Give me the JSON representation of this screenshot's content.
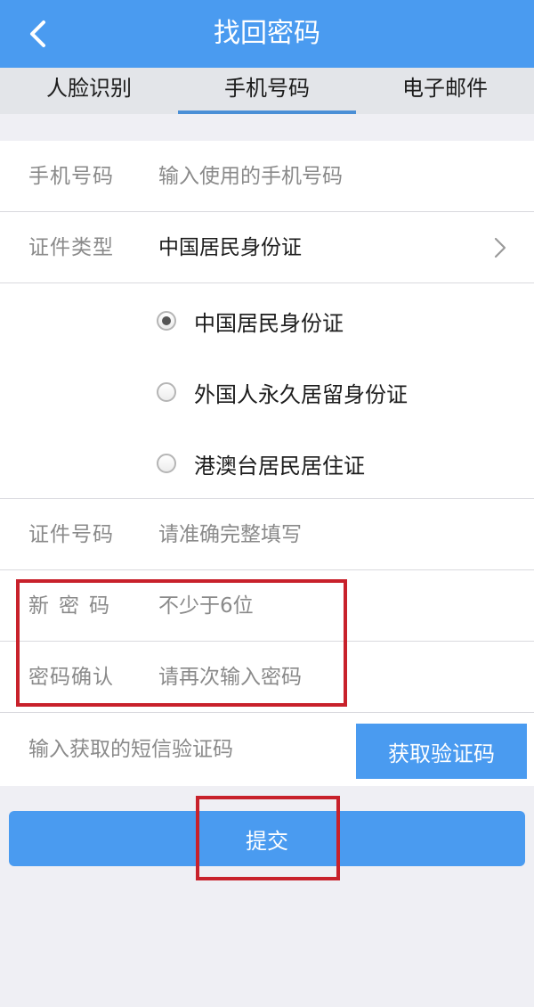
{
  "header": {
    "title": "找回密码",
    "back_icon": "chevron-left-icon"
  },
  "tabs": [
    {
      "label": "人脸识别",
      "active": false
    },
    {
      "label": "手机号码",
      "active": true
    },
    {
      "label": "电子邮件",
      "active": false
    }
  ],
  "form": {
    "phone": {
      "label": "手机号码",
      "placeholder": "输入使用的手机号码"
    },
    "id_type": {
      "label": "证件类型",
      "value": "中国居民身份证",
      "chevron_icon": "chevron-right-icon",
      "options": [
        {
          "label": "中国居民身份证",
          "selected": true
        },
        {
          "label": "外国人永久居留身份证",
          "selected": false
        },
        {
          "label": "港澳台居民居住证",
          "selected": false
        }
      ]
    },
    "id_number": {
      "label": "证件号码",
      "placeholder": "请准确完整填写"
    },
    "new_password": {
      "label": "新密码",
      "placeholder": "不少于6位"
    },
    "confirm_password": {
      "label": "密码确认",
      "placeholder": "请再次输入密码"
    },
    "sms": {
      "placeholder": "输入获取的短信验证码",
      "button_label": "获取验证码"
    }
  },
  "submit_label": "提交",
  "colors": {
    "accent": "#4a9bf0",
    "tab_underline": "#4a8fd6",
    "annotation_red": "#c8212b",
    "background": "#efeff4"
  }
}
